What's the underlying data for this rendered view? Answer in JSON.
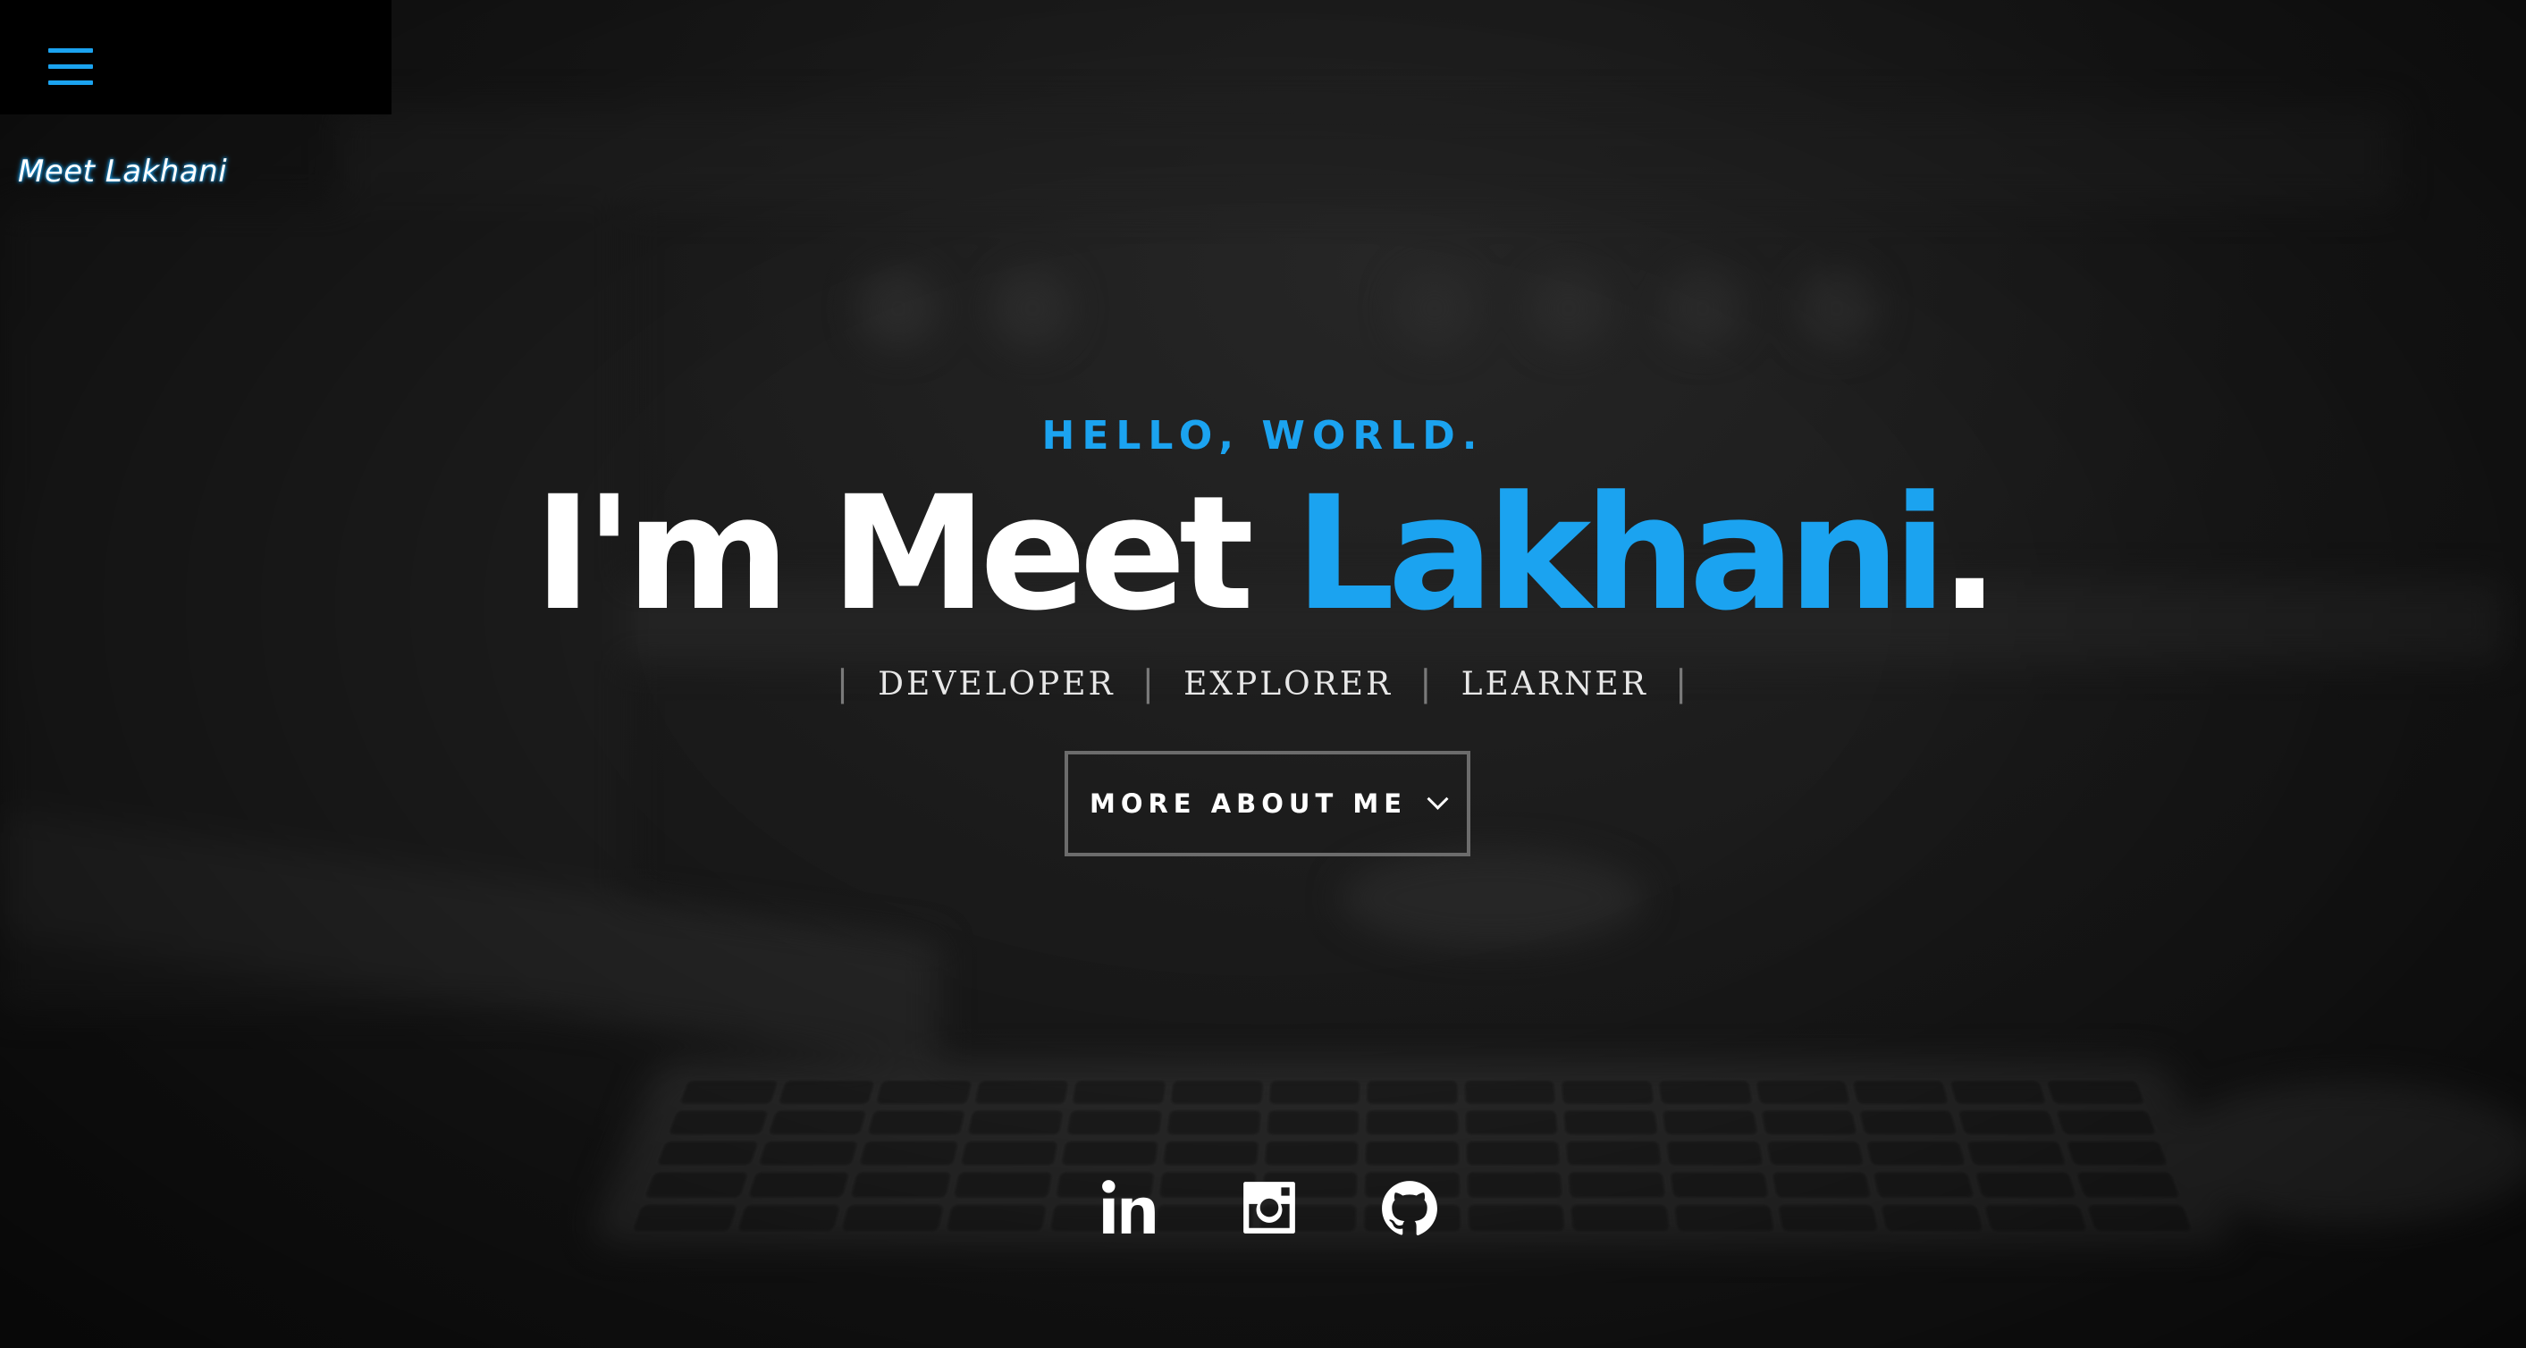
{
  "header": {
    "menu_icon": "hamburger-menu-icon",
    "brand": "Meet Lakhani"
  },
  "hero": {
    "greeting": "HELLO, WORLD.",
    "headline_prefix": "I'm Meet ",
    "headline_name": "Lakhani",
    "headline_suffix": ".",
    "roles": [
      "DEVELOPER",
      "EXPLORER",
      "LEARNER"
    ],
    "separator": "|",
    "cta_label": "MORE ABOUT ME",
    "cta_icon": "chevron-down-icon"
  },
  "social": [
    {
      "name": "linkedin",
      "icon": "linkedin-icon"
    },
    {
      "name": "instagram",
      "icon": "instagram-icon"
    },
    {
      "name": "github",
      "icon": "github-icon"
    }
  ],
  "colors": {
    "accent": "#1ba3f0",
    "text": "#ffffff",
    "background": "#161616",
    "button_border": "#6c6c6c"
  }
}
